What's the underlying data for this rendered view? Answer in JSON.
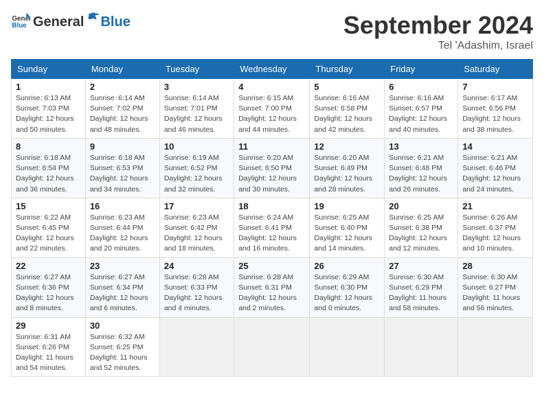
{
  "header": {
    "logo": {
      "general": "General",
      "blue": "Blue"
    },
    "title": "September 2024",
    "location": "Tel 'Adashim, Israel"
  },
  "weekdays": [
    "Sunday",
    "Monday",
    "Tuesday",
    "Wednesday",
    "Thursday",
    "Friday",
    "Saturday"
  ],
  "weeks": [
    [
      {
        "day": "1",
        "sunrise": "6:13 AM",
        "sunset": "7:03 PM",
        "daylight": "12 hours and 50 minutes."
      },
      {
        "day": "2",
        "sunrise": "6:14 AM",
        "sunset": "7:02 PM",
        "daylight": "12 hours and 48 minutes."
      },
      {
        "day": "3",
        "sunrise": "6:14 AM",
        "sunset": "7:01 PM",
        "daylight": "12 hours and 46 minutes."
      },
      {
        "day": "4",
        "sunrise": "6:15 AM",
        "sunset": "7:00 PM",
        "daylight": "12 hours and 44 minutes."
      },
      {
        "day": "5",
        "sunrise": "6:16 AM",
        "sunset": "6:58 PM",
        "daylight": "12 hours and 42 minutes."
      },
      {
        "day": "6",
        "sunrise": "6:16 AM",
        "sunset": "6:57 PM",
        "daylight": "12 hours and 40 minutes."
      },
      {
        "day": "7",
        "sunrise": "6:17 AM",
        "sunset": "6:56 PM",
        "daylight": "12 hours and 38 minutes."
      }
    ],
    [
      {
        "day": "8",
        "sunrise": "6:18 AM",
        "sunset": "6:54 PM",
        "daylight": "12 hours and 36 minutes."
      },
      {
        "day": "9",
        "sunrise": "6:18 AM",
        "sunset": "6:53 PM",
        "daylight": "12 hours and 34 minutes."
      },
      {
        "day": "10",
        "sunrise": "6:19 AM",
        "sunset": "6:52 PM",
        "daylight": "12 hours and 32 minutes."
      },
      {
        "day": "11",
        "sunrise": "6:20 AM",
        "sunset": "6:50 PM",
        "daylight": "12 hours and 30 minutes."
      },
      {
        "day": "12",
        "sunrise": "6:20 AM",
        "sunset": "6:49 PM",
        "daylight": "12 hours and 28 minutes."
      },
      {
        "day": "13",
        "sunrise": "6:21 AM",
        "sunset": "6:48 PM",
        "daylight": "12 hours and 26 minutes."
      },
      {
        "day": "14",
        "sunrise": "6:21 AM",
        "sunset": "6:46 PM",
        "daylight": "12 hours and 24 minutes."
      }
    ],
    [
      {
        "day": "15",
        "sunrise": "6:22 AM",
        "sunset": "6:45 PM",
        "daylight": "12 hours and 22 minutes."
      },
      {
        "day": "16",
        "sunrise": "6:23 AM",
        "sunset": "6:44 PM",
        "daylight": "12 hours and 20 minutes."
      },
      {
        "day": "17",
        "sunrise": "6:23 AM",
        "sunset": "6:42 PM",
        "daylight": "12 hours and 18 minutes."
      },
      {
        "day": "18",
        "sunrise": "6:24 AM",
        "sunset": "6:41 PM",
        "daylight": "12 hours and 16 minutes."
      },
      {
        "day": "19",
        "sunrise": "6:25 AM",
        "sunset": "6:40 PM",
        "daylight": "12 hours and 14 minutes."
      },
      {
        "day": "20",
        "sunrise": "6:25 AM",
        "sunset": "6:38 PM",
        "daylight": "12 hours and 12 minutes."
      },
      {
        "day": "21",
        "sunrise": "6:26 AM",
        "sunset": "6:37 PM",
        "daylight": "12 hours and 10 minutes."
      }
    ],
    [
      {
        "day": "22",
        "sunrise": "6:27 AM",
        "sunset": "6:36 PM",
        "daylight": "12 hours and 8 minutes."
      },
      {
        "day": "23",
        "sunrise": "6:27 AM",
        "sunset": "6:34 PM",
        "daylight": "12 hours and 6 minutes."
      },
      {
        "day": "24",
        "sunrise": "6:28 AM",
        "sunset": "6:33 PM",
        "daylight": "12 hours and 4 minutes."
      },
      {
        "day": "25",
        "sunrise": "6:28 AM",
        "sunset": "6:31 PM",
        "daylight": "12 hours and 2 minutes."
      },
      {
        "day": "26",
        "sunrise": "6:29 AM",
        "sunset": "6:30 PM",
        "daylight": "12 hours and 0 minutes."
      },
      {
        "day": "27",
        "sunrise": "6:30 AM",
        "sunset": "6:29 PM",
        "daylight": "11 hours and 58 minutes."
      },
      {
        "day": "28",
        "sunrise": "6:30 AM",
        "sunset": "6:27 PM",
        "daylight": "11 hours and 56 minutes."
      }
    ],
    [
      {
        "day": "29",
        "sunrise": "6:31 AM",
        "sunset": "6:26 PM",
        "daylight": "11 hours and 54 minutes."
      },
      {
        "day": "30",
        "sunrise": "6:32 AM",
        "sunset": "6:25 PM",
        "daylight": "11 hours and 52 minutes."
      },
      null,
      null,
      null,
      null,
      null
    ]
  ],
  "labels": {
    "sunrise": "Sunrise:",
    "sunset": "Sunset:",
    "daylight": "Daylight:"
  }
}
